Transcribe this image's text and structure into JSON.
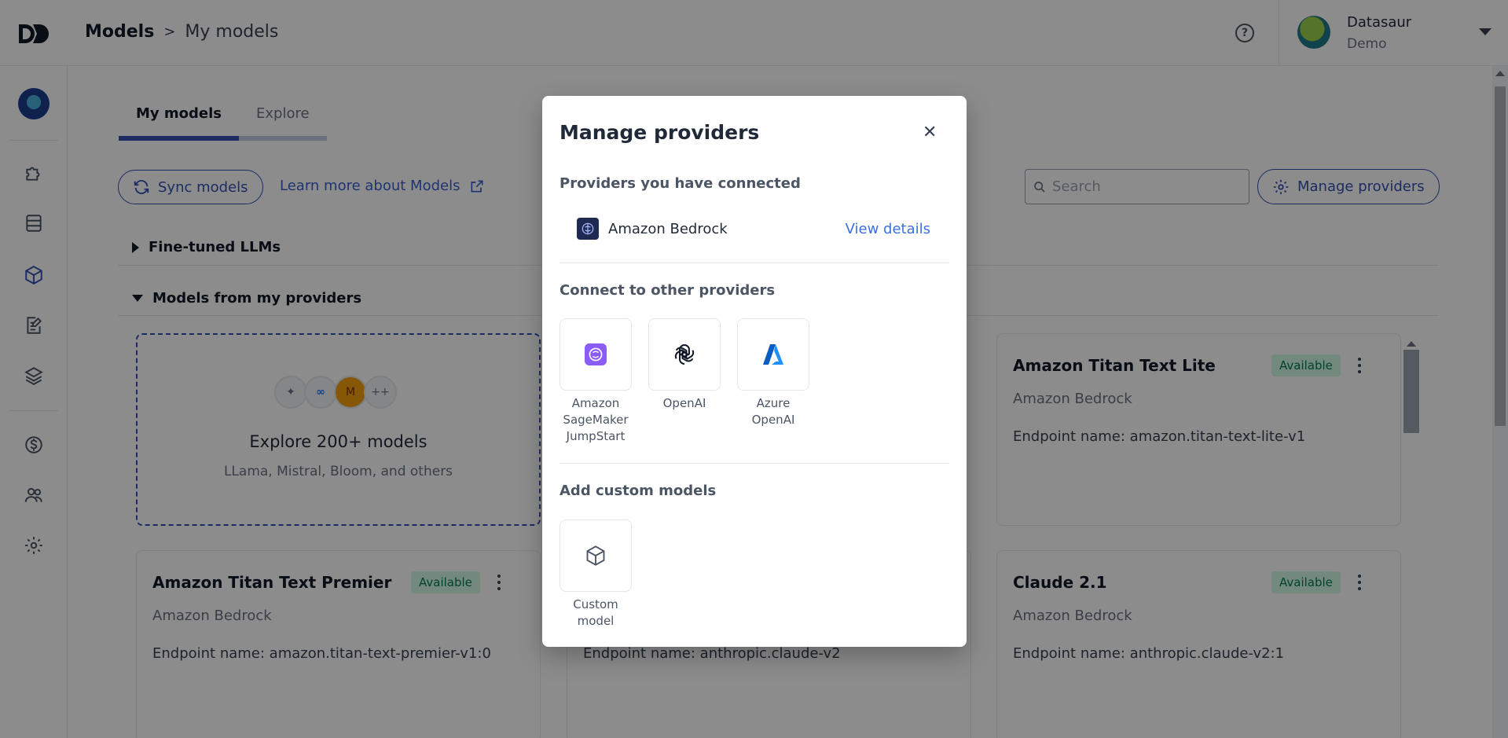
{
  "header": {
    "breadcrumb_root": "Models",
    "breadcrumb_separator": ">",
    "breadcrumb_current": "My models",
    "help_icon": "help-circle-icon",
    "user_name": "Datasaur",
    "user_team": "Demo"
  },
  "sidebar": {
    "items": [
      {
        "name": "extensions",
        "icon": "puzzle-icon"
      },
      {
        "name": "datasets",
        "icon": "database-icon"
      },
      {
        "name": "models",
        "icon": "cube-icon",
        "active": true
      },
      {
        "name": "evaluation",
        "icon": "edit-document-icon"
      },
      {
        "name": "layers",
        "icon": "layers-icon"
      },
      {
        "name": "billing",
        "icon": "dollar-icon"
      },
      {
        "name": "team",
        "icon": "team-icon"
      },
      {
        "name": "settings",
        "icon": "gear-icon"
      }
    ],
    "active_color": "#3451b2"
  },
  "main": {
    "tabs": [
      {
        "label": "My models",
        "active": true
      },
      {
        "label": "Explore",
        "active": false
      }
    ],
    "sync_button": "Sync models",
    "learn_more_link": "Learn more about Models",
    "search_placeholder": "Search",
    "manage_button": "Manage providers",
    "sections": {
      "fine_tuned": "Fine-tuned LLMs",
      "from_providers": "Models from my providers"
    },
    "explore_card": {
      "badge_more": "++",
      "title": "Explore 200+ models",
      "subtitle": "LLama, Mistral, Bloom, and others"
    },
    "model_cards": [
      {
        "title": "Amazon Titan Text Lite",
        "status": "Available",
        "provider": "Amazon Bedrock",
        "endpoint": "Endpoint name: amazon.titan-text-lite-v1"
      },
      {
        "title": "Amazon Titan Text Premier",
        "status": "Available",
        "provider": "Amazon Bedrock",
        "endpoint": "Endpoint name: amazon.titan-text-premier-v1:0"
      },
      {
        "title": "",
        "status": "",
        "provider": "",
        "endpoint": "Endpoint name: anthropic.claude-v2"
      },
      {
        "title": "Claude 2.1",
        "status": "Available",
        "provider": "Amazon Bedrock",
        "endpoint": "Endpoint name: anthropic.claude-v2:1"
      }
    ]
  },
  "modal": {
    "title": "Manage providers",
    "close_icon": "close-icon",
    "connected_header": "Providers you have connected",
    "connected": [
      {
        "name": "Amazon Bedrock",
        "action": "View details"
      }
    ],
    "other_header": "Connect to other providers",
    "other_providers": [
      {
        "label": "Amazon SageMaker JumpStart",
        "icon": "sagemaker-icon"
      },
      {
        "label": "OpenAI",
        "icon": "openai-icon"
      },
      {
        "label": "Azure OpenAI",
        "icon": "azure-icon"
      }
    ],
    "custom_header": "Add custom models",
    "custom_tile": {
      "label": "Custom model",
      "icon": "cube-outline-icon"
    }
  },
  "colors": {
    "primary": "#3451b2",
    "link": "#3a6fe0",
    "badge_bg": "#d1fae5",
    "badge_text": "#047857",
    "overlay": "rgba(0,0,0,0.45)"
  }
}
